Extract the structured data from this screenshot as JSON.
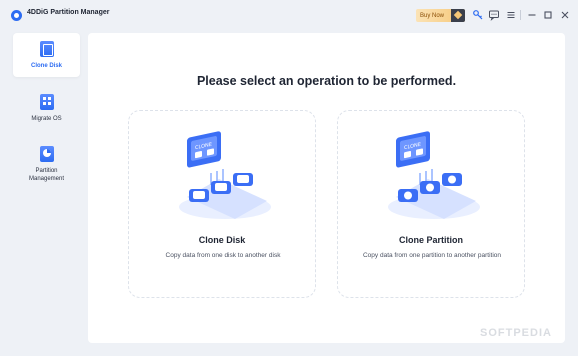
{
  "app": {
    "title": "4DDiG Partition Manager"
  },
  "titlebar": {
    "buy_label": "Buy Now",
    "icons": [
      "key-icon",
      "feedback-icon",
      "menu-icon",
      "minimize-icon",
      "maximize-icon",
      "close-icon"
    ]
  },
  "sidebar": {
    "items": [
      {
        "label": "Clone Disk",
        "icon": "clone-disk-icon",
        "active": true
      },
      {
        "label": "Migrate OS",
        "icon": "migrate-os-icon",
        "active": false
      },
      {
        "label": "Partition Management",
        "icon": "partition-management-icon",
        "active": false
      }
    ]
  },
  "main": {
    "title": "Please select an operation to be performed.",
    "cards": [
      {
        "title": "Clone Disk",
        "description": "Copy data from one disk to another disk",
        "illustration_label": "CLONE"
      },
      {
        "title": "Clone Partition",
        "description": "Copy data from one partition to another partition",
        "illustration_label": "CLONE"
      }
    ]
  },
  "watermark": "SOFTPEDIA",
  "colors": {
    "accent": "#2d6cf2",
    "background": "#eef1f6",
    "panel": "#ffffff",
    "buy_button": "#f6c777"
  }
}
